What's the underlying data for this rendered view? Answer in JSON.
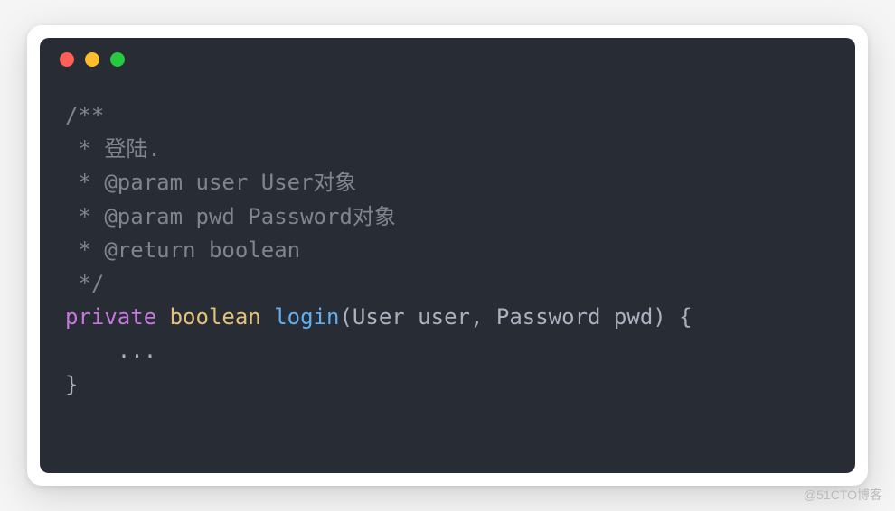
{
  "window": {
    "buttons": [
      "close",
      "minimize",
      "zoom"
    ]
  },
  "code": {
    "comment_open": "/**",
    "comment_l1": " * 登陆.",
    "comment_l2": " * @param user User对象",
    "comment_l3": " * @param pwd Password对象",
    "comment_l4": " * @return boolean",
    "comment_close": " */",
    "kw_private": "private",
    "kw_boolean": "boolean",
    "fn_name": "login",
    "sig_open": "(",
    "param1_type": "User",
    "param1_name": "user",
    "sep": ", ",
    "param2_type": "Password",
    "param2_name": "pwd",
    "sig_close": ")",
    "brace_open": " {",
    "body": "    ...",
    "brace_close": "}"
  },
  "watermark": "@51CTO博客"
}
